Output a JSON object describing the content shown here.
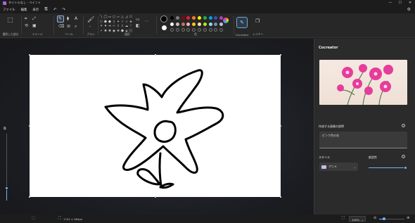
{
  "window": {
    "title": "タイトルなし - ペイント",
    "controls": [
      "—",
      "☐",
      "✕"
    ]
  },
  "menu": {
    "items": [
      "ファイル",
      "編集",
      "表示"
    ],
    "icons": [
      "save-icon",
      "undo-icon",
      "redo-icon",
      "settings-icon"
    ]
  },
  "toolbar": {
    "groups": {
      "selection": "選択した部分",
      "image": "イメージ",
      "tools": "ツール",
      "brush": "ブラシ",
      "shapes": "図形",
      "colors": "色",
      "cocreator": "Cocreator",
      "layers": "レイヤー"
    },
    "shape_glyphs": [
      "╲",
      "◯",
      "▭",
      "▢",
      "▱",
      "△",
      "◿",
      "⬠",
      "⬡",
      "⬢",
      "⬣",
      "◊",
      "✦",
      "✧",
      "☆",
      "✬",
      "✶",
      "✷",
      "➜",
      "⇦",
      "⇧",
      "⇩",
      "☁",
      "♡",
      "⚡",
      "✺",
      "✱",
      "◉",
      "❖",
      "⬟",
      "⬙",
      "⬛"
    ],
    "primary_color": "#000000",
    "secondary_color": "#ffffff",
    "palette_row1": [
      "#000000",
      "#7f7f7f",
      "#880015",
      "#ed1c24",
      "#ff7f27",
      "#fff200",
      "#22b14c",
      "#00a2e8",
      "#3f48cc",
      "#a349a4"
    ],
    "palette_row2": [
      "#ffffff",
      "#c3c3c3",
      "#b97a57",
      "#ffaec9",
      "#ffc90e",
      "#efe4b0",
      "#b5e61d",
      "#99d9ea",
      "#7092be",
      "#c8bfe7"
    ],
    "palette_row3": [
      "",
      "",
      "",
      "",
      "",
      "",
      "",
      "",
      "",
      ""
    ]
  },
  "cocreator": {
    "title": "Cocreator",
    "prompt_label": "作成する画像の説明",
    "prompt_value": "ピンク色の花",
    "style_label": "スタイル",
    "style_value": "アニメ",
    "creativity_label": "創造性",
    "creativity_level": 1.0
  },
  "status": {
    "dimensions": "1741 × 984px",
    "zoom": "100%",
    "zoom_slider_level": 0.18
  }
}
